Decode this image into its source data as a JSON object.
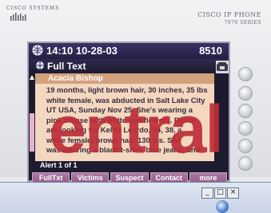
{
  "brand": {
    "left": "CISCO SYSTEMS",
    "right_line1": "CISCO IP PHONE",
    "right_line2": "7970 SERIES"
  },
  "status_bar": {
    "datetime": "14:10 10-28-03",
    "extension": "8510"
  },
  "screen": {
    "title": "Full Text",
    "contact_name": "Acacia Bishop",
    "body_lines": [
      "19 months, light brown hair, 30 inches, 35 lbs",
      "white female, was abducted in Salt Lake City",
      "UT USA, Sunday Nov 25. She's wearing a",
      "pink blouse with white sun flowers. Police",
      "are looking for Keller Leardo, 34, 38, a",
      "white female, brown hair, 130 lbs. She",
      "was wearing a black t-shirt, blue jeans, and"
    ],
    "alert_counter": "Alert 1 of 1"
  },
  "softkeys": [
    {
      "label": "FullTxt"
    },
    {
      "label": "Victims"
    },
    {
      "label": "Suspect"
    },
    {
      "label": "Contact"
    },
    {
      "label": "more"
    }
  ],
  "watermark": "entral",
  "window": {
    "minimize": "_",
    "maximize": "□",
    "close": "×"
  },
  "colors": {
    "watermark": "#be2d37",
    "softkey": "#9a6696",
    "content_bg": "#f3d8bf",
    "name_bar": "#d2a27c"
  }
}
